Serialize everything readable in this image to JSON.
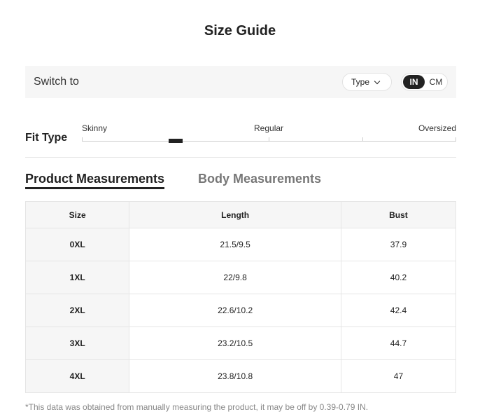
{
  "title": "Size Guide",
  "switch_bar": {
    "label": "Switch to",
    "type_dropdown": "Type",
    "unit_in": "IN",
    "unit_cm": "CM",
    "selected_unit": "IN"
  },
  "fit_type": {
    "label": "Fit Type",
    "options": [
      "Skinny",
      "Regular",
      "Oversized"
    ],
    "selected_level": 0.25
  },
  "tabs": {
    "product": "Product Measurements",
    "body": "Body Measurements",
    "active": "Product Measurements"
  },
  "table": {
    "headers": [
      "Size",
      "Length",
      "Bust"
    ],
    "rows": [
      [
        "0XL",
        "21.5/9.5",
        "37.9"
      ],
      [
        "1XL",
        "22/9.8",
        "40.2"
      ],
      [
        "2XL",
        "22.6/10.2",
        "42.4"
      ],
      [
        "3XL",
        "23.2/10.5",
        "44.7"
      ],
      [
        "4XL",
        "23.8/10.8",
        "47"
      ]
    ]
  },
  "footnote": "*This data was obtained from manually measuring the product, it may be off by 0.39-0.79 IN."
}
